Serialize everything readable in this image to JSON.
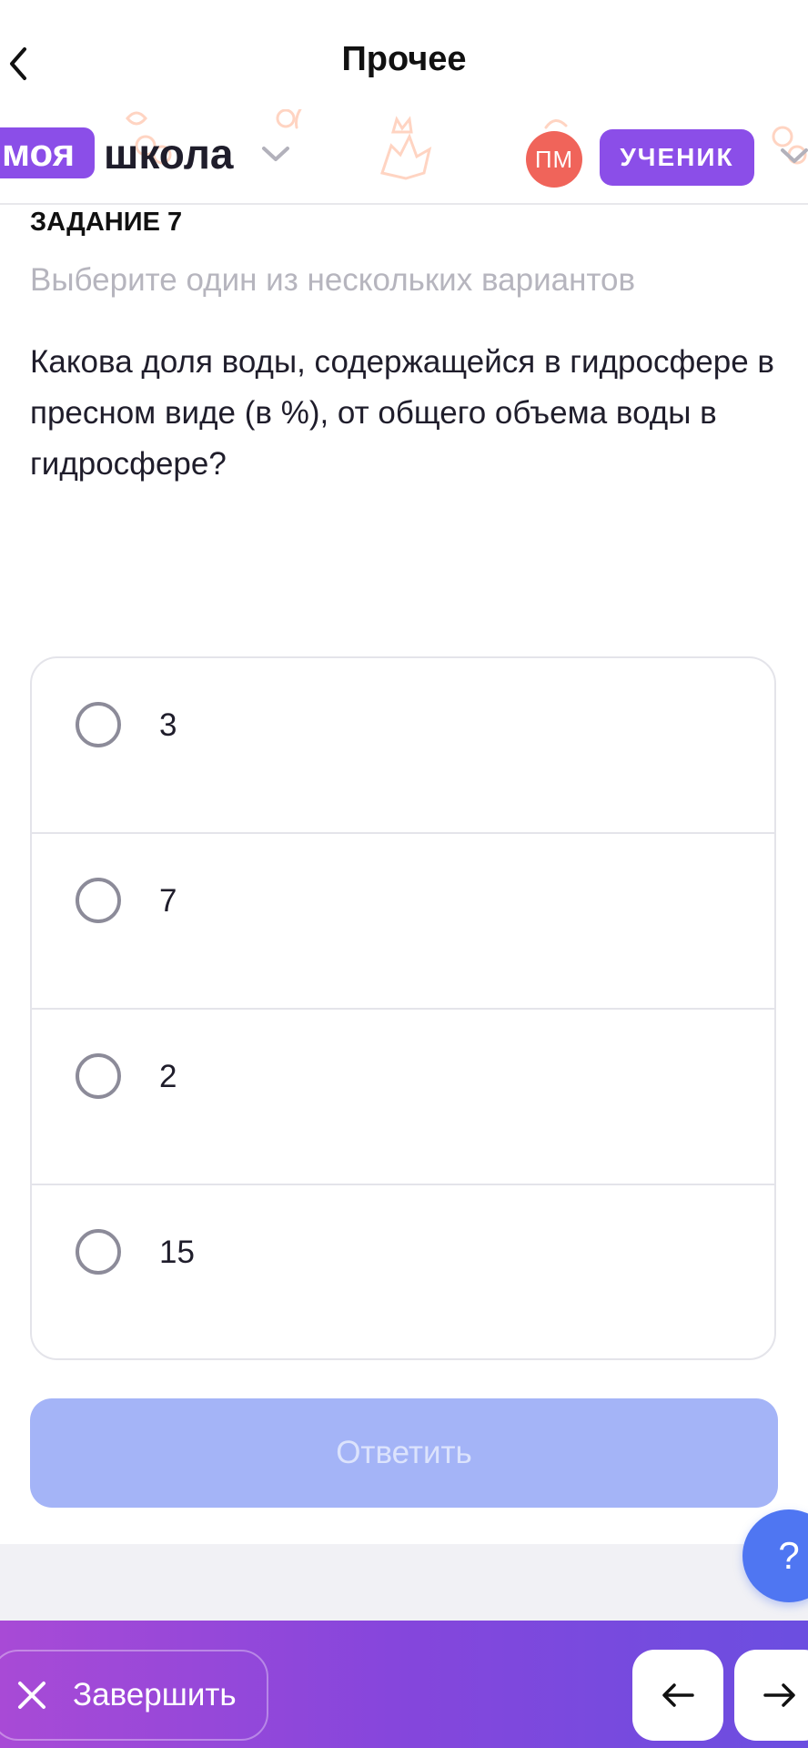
{
  "header": {
    "title": "Прочее"
  },
  "brand": {
    "logo_tag": "моя",
    "logo_word": "школа"
  },
  "user": {
    "initials": "ПМ",
    "role": "УЧЕНИК"
  },
  "task": {
    "label": "ЗАДАНИЕ 7",
    "hint": "Выберите один из нескольких вариантов",
    "question": "Какова доля воды, содержащейся в гидросфере в пресном виде (в %), от общего объема воды в гидросфере?"
  },
  "options": [
    "3",
    "7",
    "2",
    "15"
  ],
  "answer_button": "Ответить",
  "help_button": "?",
  "bottom": {
    "finish_label": "Завершить"
  },
  "colors": {
    "accent": "#8b4ee8",
    "avatar": "#f0645a",
    "answer_disabled": "#a4b4f7",
    "help": "#4f76f2"
  }
}
